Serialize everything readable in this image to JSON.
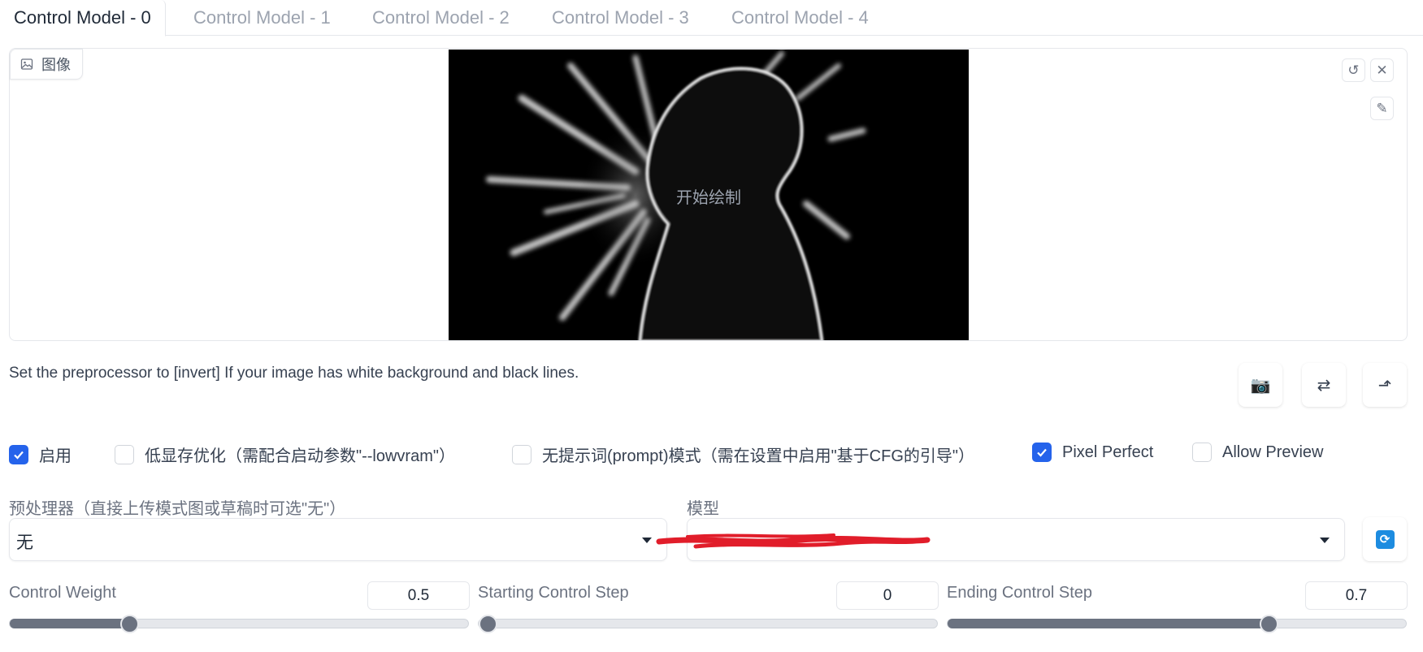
{
  "tabs": [
    {
      "label": "Control Model - 0",
      "active": true
    },
    {
      "label": "Control Model - 1",
      "active": false
    },
    {
      "label": "Control Model - 2",
      "active": false
    },
    {
      "label": "Control Model - 3",
      "active": false
    },
    {
      "label": "Control Model - 4",
      "active": false
    }
  ],
  "image_panel": {
    "label": "图像",
    "caption": "开始绘制",
    "buttons": [
      "undo-icon",
      "close-icon",
      "brush-icon"
    ]
  },
  "hint": "Set the preprocessor to [invert] If your image has white background and black lines.",
  "tools": [
    {
      "icon": "camera-icon",
      "glyph": "📷"
    },
    {
      "icon": "swap-icon",
      "glyph": "⇄"
    },
    {
      "icon": "send-icon",
      "glyph": "⬏"
    }
  ],
  "checkboxes": [
    {
      "label": "启用",
      "checked": true
    },
    {
      "label": "低显存优化（需配合启动参数\"--lowvram\"）",
      "checked": false
    },
    {
      "label": "无提示词(prompt)模式（需在设置中启用\"基于CFG的引导\"）",
      "checked": false
    },
    {
      "label": "Pixel Perfect",
      "checked": true
    },
    {
      "label": "Allow Preview",
      "checked": false
    }
  ],
  "preprocessor": {
    "label": "预处理器（直接上传模式图或草稿时可选\"无\"）",
    "value": "无"
  },
  "model": {
    "label": "模型",
    "value": ""
  },
  "sliders": [
    {
      "label": "Control Weight",
      "value": "0.5",
      "fraction": 0.26
    },
    {
      "label": "Starting Control Step",
      "value": "0",
      "fraction": 0.0
    },
    {
      "label": "Ending Control Step",
      "value": "0.7",
      "fraction": 0.7
    }
  ],
  "colors": {
    "accent": "#2563eb",
    "refresh": "#1d8ce0",
    "redaction": "#e11d2a"
  }
}
